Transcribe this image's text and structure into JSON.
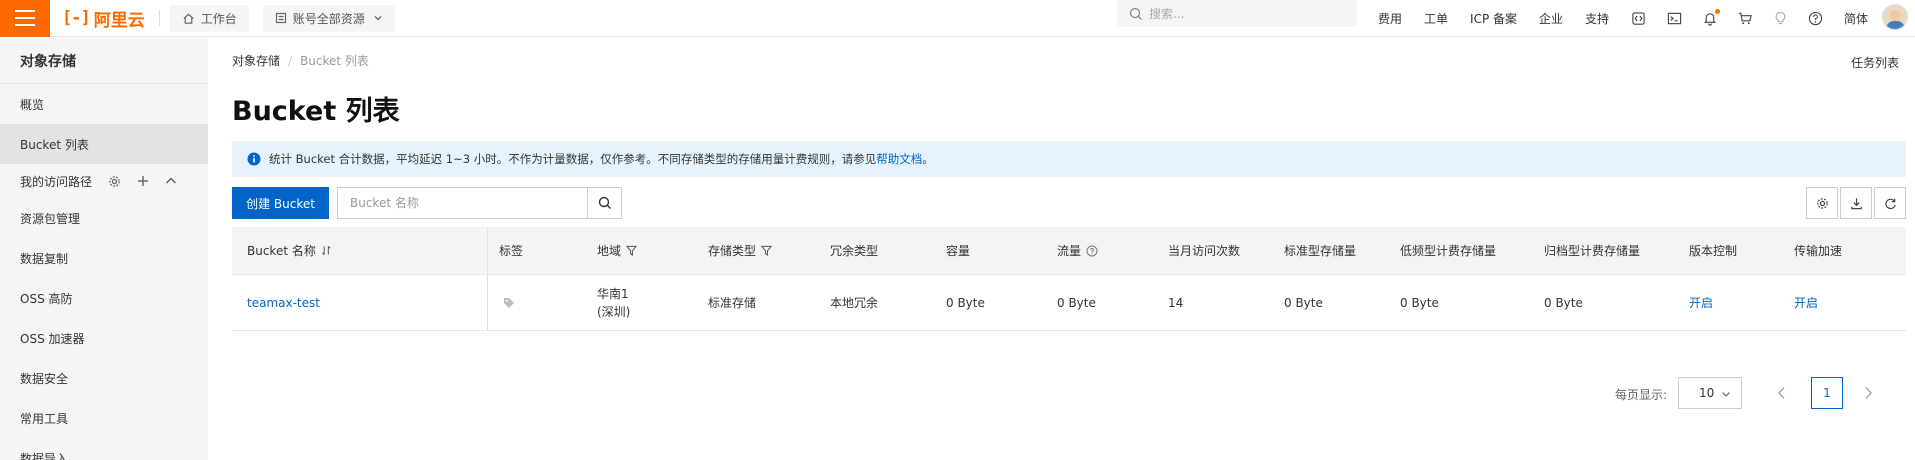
{
  "brand": {
    "logo_mark": "[-]",
    "logo_text": "阿里云",
    "color": "#ff6a00"
  },
  "topbar": {
    "workbench": "工作台",
    "resources": "账号全部资源",
    "search_placeholder": "搜索...",
    "links": [
      "费用",
      "工单",
      "ICP 备案",
      "企业",
      "支持"
    ],
    "lang": "简体",
    "icons": [
      "code-icon",
      "terminal-icon",
      "bell-icon",
      "cart-icon",
      "lightbulb-icon",
      "help-icon"
    ]
  },
  "sidebar": {
    "title": "对象存储",
    "items": [
      "概览",
      "Bucket 列表"
    ],
    "active": "Bucket 列表",
    "group_label": "我的访问路径",
    "sub_items": [
      "资源包管理",
      "数据复制",
      "OSS 高防",
      "OSS 加速器",
      "数据安全",
      "常用工具",
      "数据导入"
    ]
  },
  "breadcrumb": {
    "root": "对象存储",
    "current": "Bucket 列表"
  },
  "task_list": "任务列表",
  "page_title": "Bucket 列表",
  "notice": {
    "text": "统计 Bucket 合计数据，平均延迟 1~3 小时。不作为计量数据，仅作参考。不同存储类型的存储用量计费规则，请参见",
    "link": "帮助文档",
    "suffix": "。"
  },
  "toolbar": {
    "create_label": "创建 Bucket",
    "search_placeholder": "Bucket 名称"
  },
  "table": {
    "headers": {
      "name": "Bucket 名称",
      "tags": "标签",
      "region": "地域",
      "storage_class": "存储类型",
      "redundancy": "冗余类型",
      "capacity": "容量",
      "traffic": "流量",
      "visits": "当月访问次数",
      "standard": "标准型存储量",
      "ia": "低频型计费存储量",
      "archive": "归档型计费存储量",
      "versioning": "版本控制",
      "transfer": "传输加速"
    },
    "rows": [
      {
        "name": "teamax-test",
        "region_line1": "华南1",
        "region_line2": "(深圳)",
        "storage_class": "标准存储",
        "redundancy": "本地冗余",
        "capacity": "0 Byte",
        "traffic": "0 Byte",
        "visits": "14",
        "standard": "0 Byte",
        "ia": "0 Byte",
        "archive": "0 Byte",
        "versioning": "开启",
        "transfer": "开启"
      }
    ]
  },
  "pager": {
    "page_size_label": "每页显示:",
    "page_size": "10",
    "current_page": "1"
  },
  "colors": {
    "accent": "#ff6a00",
    "primary": "#0064c8",
    "notice_bg": "#e6f3fd"
  }
}
